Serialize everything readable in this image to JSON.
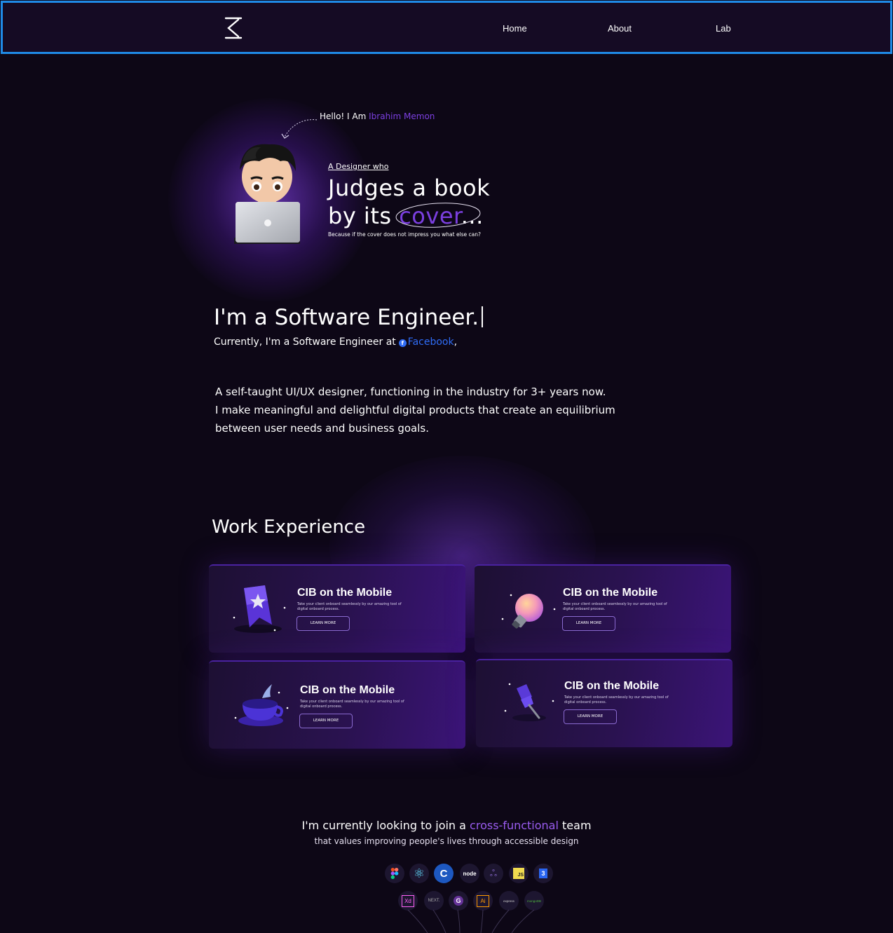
{
  "nav": {
    "logo": "logo-icon",
    "items": [
      "Home",
      "About",
      "Lab"
    ]
  },
  "hero": {
    "hello_prefix": "Hello! I Am",
    "hello_name": "Ibrahim Memon",
    "designer_line": "A Designer who",
    "headline_1": "Judges a book",
    "headline_2_prefix": "by its",
    "headline_2_highlight": "cover",
    "headline_2_suffix": "...",
    "tagline": "Because if the cover does not impress you what else can?"
  },
  "intro": {
    "role_line": "I'm a Software Engineer.",
    "current_prefix": "Currently, I'm a Software Engineer at",
    "company": "Facebook",
    "current_suffix": ",",
    "bio_1": "A self-taught UI/UX designer, functioning in the industry for 3+ years now.",
    "bio_2": "I make meaningful and delightful digital products that create an equilibrium",
    "bio_3": "between user needs and business goals."
  },
  "work": {
    "title": "Work Experience",
    "cards": [
      {
        "title": "CIB on the Mobile",
        "desc": "Take your client onboard seamlessly by our amazing tool of digital onboard process.",
        "button": "LEARN MORE",
        "icon": "bookmark-star-icon"
      },
      {
        "title": "CIB on the Mobile",
        "desc": "Take your client onboard seamlessly by our amazing tool of digital onboard process.",
        "button": "LEARN MORE",
        "icon": "lightbulb-icon"
      },
      {
        "title": "CIB on the Mobile",
        "desc": "Take your client onboard seamlessly by our amazing tool of digital onboard process.",
        "button": "LEARN MORE",
        "icon": "coffee-cup-icon"
      },
      {
        "title": "CIB on the Mobile",
        "desc": "Take your client onboard seamlessly by our amazing tool of digital onboard process.",
        "button": "LEARN MORE",
        "icon": "pin-icon"
      }
    ]
  },
  "join": {
    "prefix": "I'm currently looking to join a",
    "highlight": "cross-functional",
    "suffix": "team",
    "sub": "that values improving people's lives through accessible design"
  },
  "tech_row_1": [
    {
      "icon": "figma-icon",
      "label": ""
    },
    {
      "icon": "react-icon",
      "label": "⚛"
    },
    {
      "icon": "c-icon",
      "label": "C"
    },
    {
      "icon": "node-icon",
      "label": "node"
    },
    {
      "icon": "redux-icon",
      "label": "ஃ"
    },
    {
      "icon": "javascript-icon",
      "label": "JS"
    },
    {
      "icon": "css3-icon",
      "label": "3"
    }
  ],
  "tech_row_2": [
    {
      "icon": "adobe-xd-icon",
      "label": "Xd"
    },
    {
      "icon": "nextjs-icon",
      "label": "NEXT."
    },
    {
      "icon": "gatsby-icon",
      "label": "G"
    },
    {
      "icon": "illustrator-icon",
      "label": "Ai"
    },
    {
      "icon": "express-icon",
      "label": "express"
    },
    {
      "icon": "mongodb-icon",
      "label": "mongoDB"
    }
  ],
  "colors": {
    "accent": "#7b3fe0",
    "facebook": "#2f6cf5",
    "nav_border": "#1f8ae6",
    "background": "#0d0716"
  }
}
